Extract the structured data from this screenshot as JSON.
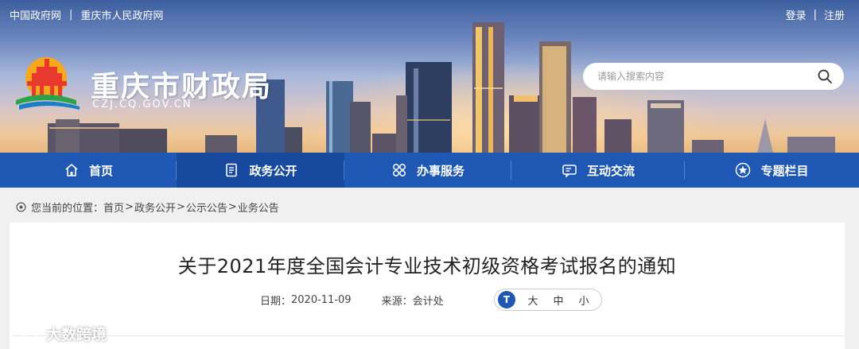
{
  "top_links": {
    "gov_portal": "中国政府网",
    "city_portal": "重庆市人民政府网",
    "separator": "|"
  },
  "auth": {
    "login": "登录",
    "register": "注册",
    "separator": "|"
  },
  "site": {
    "title": "重庆市财政局",
    "domain": "CZJ.CQ.GOV.CN"
  },
  "search": {
    "placeholder": "请输入搜索内容",
    "icon": "search-icon"
  },
  "nav": {
    "items": [
      {
        "label": "首页",
        "icon": "home-icon",
        "active": false
      },
      {
        "label": "政务公开",
        "icon": "document-icon",
        "active": true
      },
      {
        "label": "办事服务",
        "icon": "services-icon",
        "active": false
      },
      {
        "label": "互动交流",
        "icon": "chat-icon",
        "active": false
      },
      {
        "label": "专题栏目",
        "icon": "star-icon",
        "active": false
      }
    ]
  },
  "breadcrumb": {
    "prefix": "您当前的位置：",
    "items": [
      "首页",
      "政务公开",
      "公示公告",
      "业务公告"
    ],
    "separator": ">"
  },
  "article": {
    "title": "关于2021年度全国会计专业技术初级资格考试报名的通知",
    "date_label": "日期：",
    "date": "2020-11-09",
    "source_label": "来源：",
    "source": "会计处"
  },
  "font_size": {
    "icon_label": "T",
    "large": "大",
    "medium": "中",
    "small": "小"
  },
  "watermark": {
    "text": "大数跨境"
  },
  "colors": {
    "nav_bg": "#1e58b4",
    "nav_active": "#174a9e",
    "accent": "#1e58b4"
  }
}
